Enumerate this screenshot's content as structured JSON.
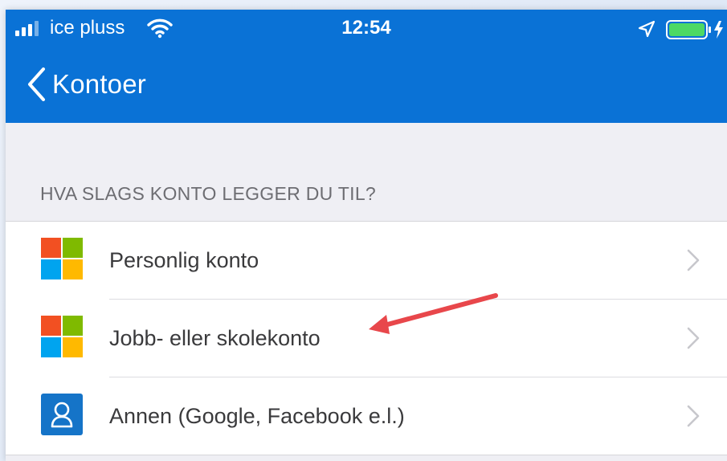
{
  "status_bar": {
    "carrier": "ice pluss",
    "time": "12:54"
  },
  "nav": {
    "back_label": "Kontoer"
  },
  "section": {
    "header": "HVA SLAGS KONTO LEGGER DU TIL?"
  },
  "accounts": [
    {
      "label": "Personlig konto",
      "icon": "microsoft-logo-icon"
    },
    {
      "label": "Jobb- eller skolekonto",
      "icon": "microsoft-logo-icon"
    },
    {
      "label": "Annen (Google, Facebook e.l.)",
      "icon": "person-icon"
    }
  ],
  "colors": {
    "nav_blue": "#0a72d6",
    "ms_red": "#f25022",
    "ms_green": "#7fba00",
    "ms_blue": "#00a4ef",
    "ms_yellow": "#ffb900",
    "battery_green": "#4cd964",
    "annotation_arrow": "#e8474b"
  }
}
